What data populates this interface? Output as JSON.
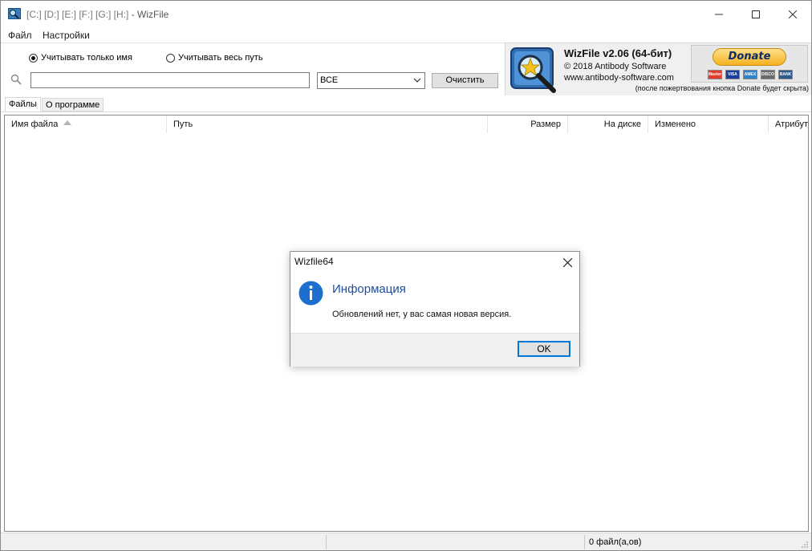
{
  "window": {
    "title_drives": "[C:] [D:] [E:] [F:] [G:] [H:]",
    "title_app": " - WizFile"
  },
  "menu": {
    "file": "Файл",
    "settings": "Настройки"
  },
  "options": {
    "radio_name_only": "Учитывать только имя",
    "radio_name_only_checked": true,
    "radio_full_path": "Учитывать весь путь",
    "radio_full_path_checked": false,
    "search_value": "",
    "filter_selected": "ВСЕ",
    "clear_label": "Очистить"
  },
  "brand": {
    "title": "WizFile v2.06 (64-бит)",
    "copyright": "© 2018 Antibody Software",
    "url": "www.antibody-software.com",
    "donate_label": "Donate",
    "cards": [
      "MasterCard",
      "VISA",
      "AMEX",
      "DISCOVER",
      "BANK"
    ],
    "note": "(после пожертвования кнопка Donate будет скрыта)"
  },
  "tabs": [
    {
      "label": "Файлы",
      "active": true
    },
    {
      "label": "О программе",
      "active": false
    }
  ],
  "columns": {
    "name": "Имя файла",
    "path": "Путь",
    "size": "Размер",
    "on_disk": "На диске",
    "modified": "Изменено",
    "attributes": "Атрибут"
  },
  "status": {
    "files": "0 файл(а,ов)"
  },
  "dialog": {
    "title": "Wizfile64",
    "heading": "Информация",
    "message": "Обновлений нет, у вас самая новая версия.",
    "ok_label": "OK"
  },
  "colors": {
    "accent": "#0078d7",
    "dialog_heading": "#1e4e9b",
    "donate": "#f5b120"
  }
}
